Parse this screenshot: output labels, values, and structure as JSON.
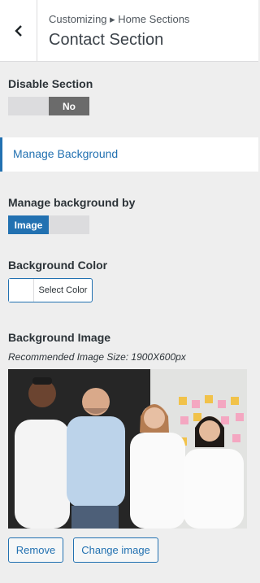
{
  "header": {
    "breadcrumb": "Customizing ▸ Home Sections",
    "title": "Contact Section"
  },
  "disable_section": {
    "label": "Disable Section",
    "off_label": "",
    "on_label": "No"
  },
  "manage_background_section": {
    "label": "Manage Background"
  },
  "manage_background_by": {
    "label": "Manage background by",
    "selected": "Image",
    "other": ""
  },
  "background_color": {
    "label": "Background Color",
    "button_label": "Select Color",
    "value": "#ffffff"
  },
  "background_image": {
    "label": "Background Image",
    "hint": "Recommended Image Size: 1900X600px"
  },
  "buttons": {
    "remove": "Remove",
    "change_image": "Change image"
  },
  "colors": {
    "accent": "#2271b1",
    "panel_bg": "#eeeeee",
    "toggle_dark": "#6b6b6b"
  }
}
